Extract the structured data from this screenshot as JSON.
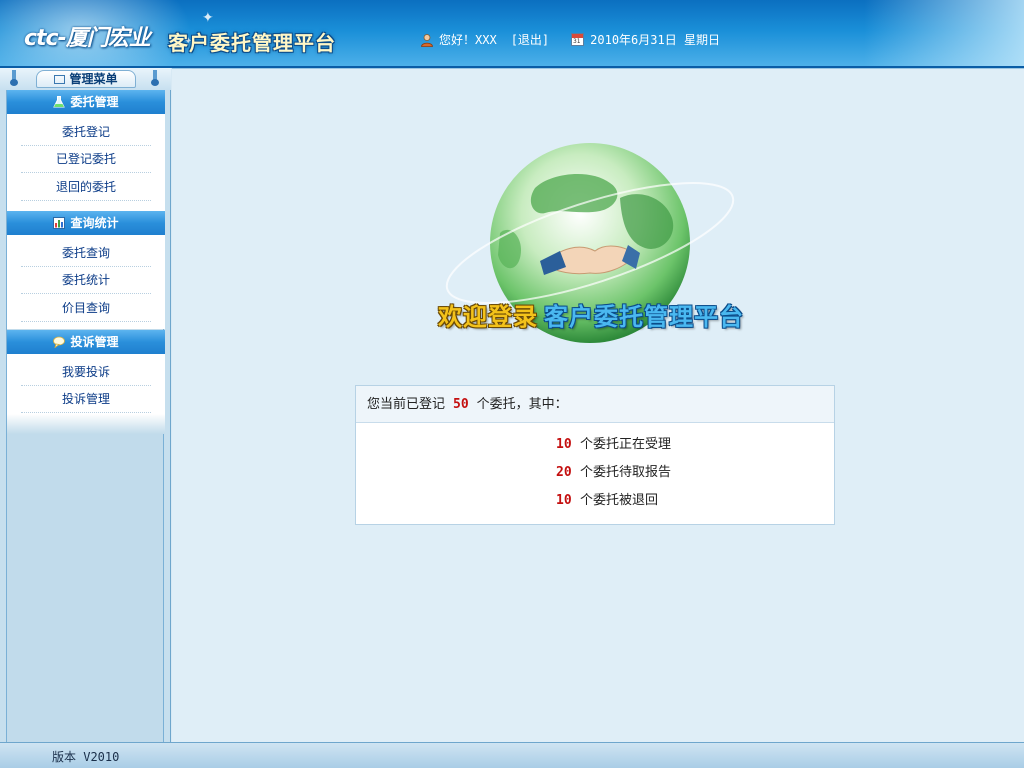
{
  "header": {
    "logo": "ctc-厦门宏业",
    "platform_title": "客户委托管理平台",
    "greeting": "您好！XXX",
    "logout_label": "[退出]",
    "date": "2010年6月31日  星期日",
    "calendar_day": "31"
  },
  "sidebar": {
    "menu_title": "管理菜单",
    "sections": [
      {
        "title": "委托管理",
        "icon": "flask-icon",
        "items": [
          {
            "label": "委托登记"
          },
          {
            "label": "已登记委托"
          },
          {
            "label": "退回的委托"
          }
        ]
      },
      {
        "title": "查询统计",
        "icon": "chart-icon",
        "items": [
          {
            "label": "委托查询"
          },
          {
            "label": "委托统计"
          },
          {
            "label": "价目查询"
          }
        ]
      },
      {
        "title": "投诉管理",
        "icon": "speech-bubble-icon",
        "items": [
          {
            "label": "我要投诉"
          },
          {
            "label": "投诉管理"
          }
        ]
      }
    ]
  },
  "main": {
    "welcome": "欢迎登录",
    "welcome_platform": "客户委托管理平台",
    "summary_prefix": "您当前已登记",
    "summary_count": "50",
    "summary_suffix": "个委托，其中：",
    "rows": [
      {
        "count": "10",
        "text": "个委托正在受理"
      },
      {
        "count": "20",
        "text": "个委托待取报告"
      },
      {
        "count": "10",
        "text": "个委托被退回"
      }
    ]
  },
  "footer": {
    "version": "版本 V2010"
  },
  "colors": {
    "header_blue": "#1a8fd8",
    "number_red": "#c40f0f",
    "link_blue": "#0b3b87"
  }
}
